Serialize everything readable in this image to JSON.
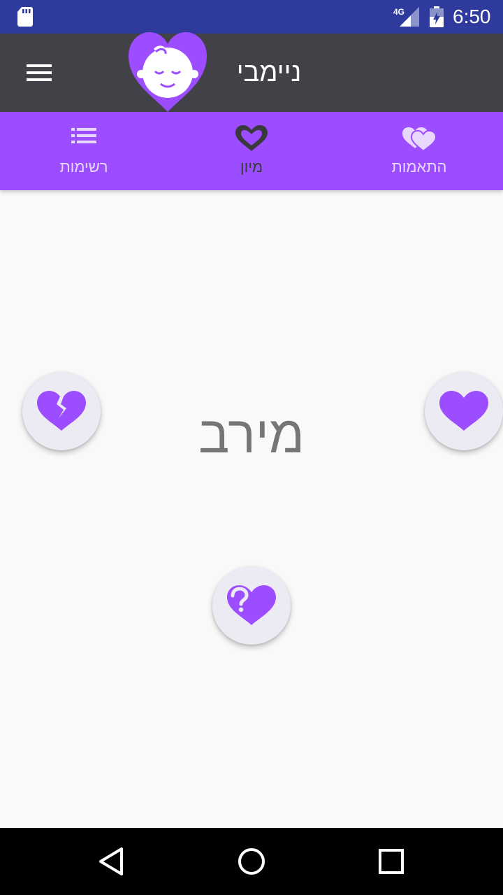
{
  "status_bar": {
    "time": "6:50",
    "network": "4G",
    "icons": [
      "sd-card-icon",
      "signal-icon",
      "battery-icon"
    ],
    "color": "#2e3b9c"
  },
  "app_bar": {
    "title": "ניימבי",
    "menu_icon": "hamburger-menu-icon",
    "logo_icon": "baby-heart-logo-icon",
    "color": "#424147"
  },
  "tabs": [
    {
      "label": "רשימות",
      "icon": "list-icon",
      "active": false
    },
    {
      "label": "מיון",
      "icon": "heart-outline-icon",
      "active": true
    },
    {
      "label": "התאמות",
      "icon": "double-heart-icon",
      "active": false
    }
  ],
  "main": {
    "current_name": "מירב",
    "actions": {
      "dislike_icon": "broken-heart-icon",
      "like_icon": "heart-icon",
      "maybe_icon": "question-heart-icon"
    }
  },
  "nav_bar": {
    "icons": [
      "back-icon",
      "home-icon",
      "recents-icon"
    ]
  },
  "colors": {
    "accent": "#9c4dff",
    "tab_inactive_text": "#e8d8ff",
    "tab_active_text": "#3a3a3e",
    "fab_background": "#eceaf2",
    "name_text": "#757575",
    "background": "#f9f9f9"
  }
}
